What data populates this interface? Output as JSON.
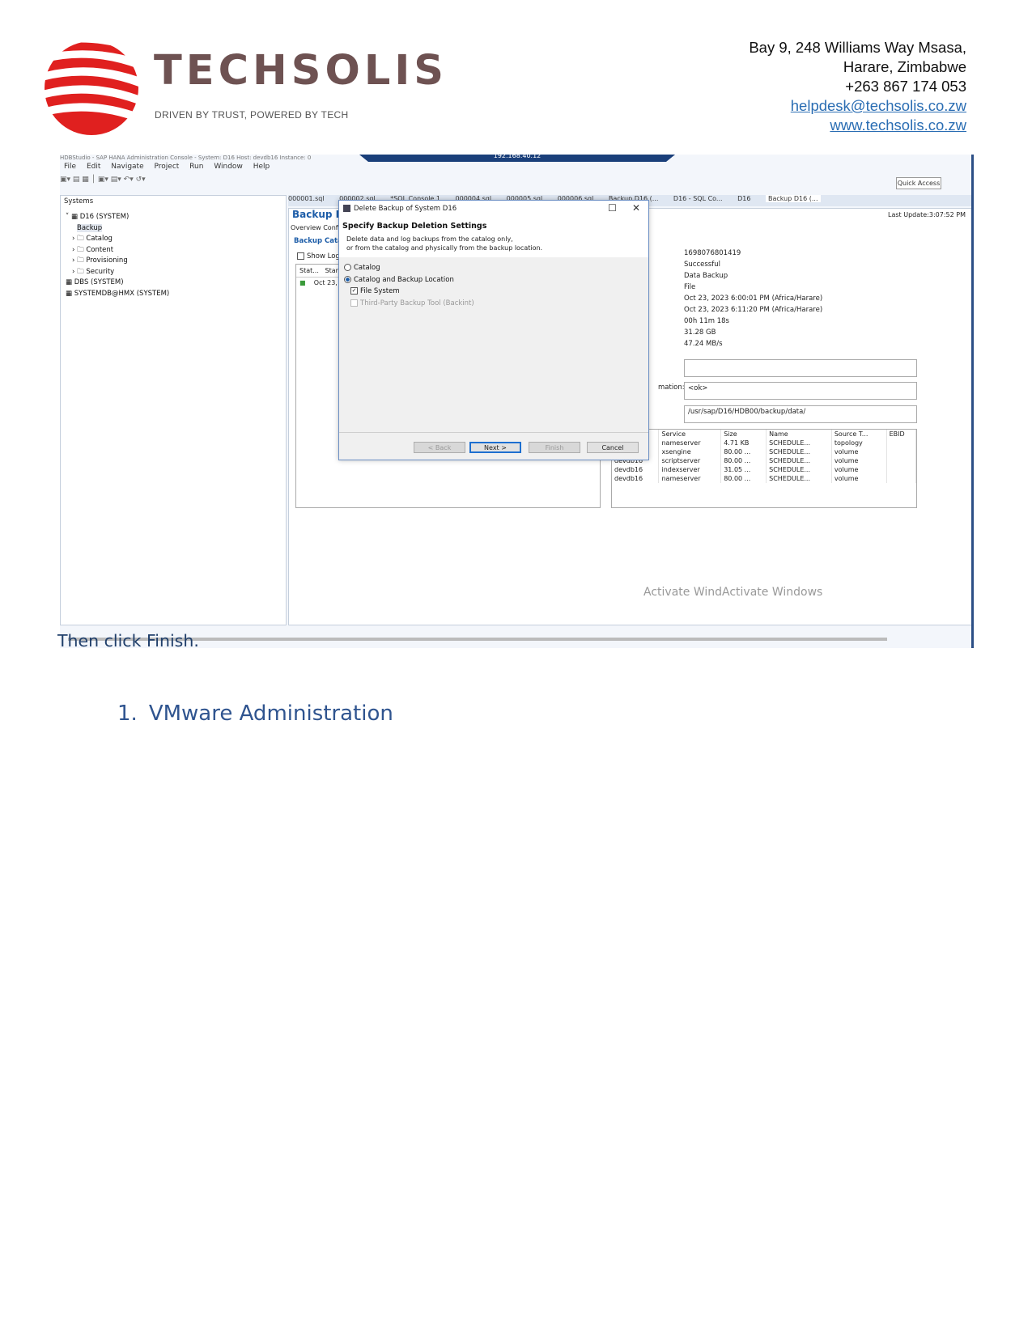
{
  "header": {
    "brand_name": "TECHSOLIS",
    "tagline": "DRIVEN BY TRUST, POWERED BY TECH",
    "address_line1": "Bay 9, 248 Williams Way Msasa,",
    "address_line2": "Harare, Zimbabwe",
    "phone": "+263 867 174 053",
    "email": "helpdesk@techsolis.co.zw",
    "website": "www.techsolis.co.zw"
  },
  "screenshot": {
    "window_title": "HDBStudio - SAP HANA Administration Console - System: D16 Host: devdb16 Instance: 0",
    "vpn_bar": "192.168.40.12",
    "menu": [
      "File",
      "Edit",
      "Navigate",
      "Project",
      "Run",
      "Window",
      "Help"
    ],
    "quick_access": "Quick Access",
    "systems_tab": "Systems",
    "tree": {
      "root": "D16 (SYSTEM)",
      "backup": "Backup",
      "catalog": "Catalog",
      "content": "Content",
      "provisioning": "Provisioning",
      "security": "Security",
      "dbs": "DBS (SYSTEM)",
      "systemdb": "SYSTEMDB@HMX (SYSTEM)"
    },
    "editor_tabs": [
      "000001.sql",
      "000002.sql",
      "*SQL Console 1",
      "000004.sql",
      "000005.sql",
      "000006.sql",
      "Backup D16 (...",
      "D16 - SQL Co...",
      "D16",
      "Backup D16 (..."
    ],
    "editor_title": "Backup D16",
    "last_update": "Last Update:3:07:52 PM",
    "subtabs": [
      "Overview",
      "Configura"
    ],
    "backup_catalog": "Backup Catalog",
    "show_log": "Show Log Back",
    "table_headers": [
      "Stat...",
      "Started"
    ],
    "table_row": "Oct 23, 20",
    "details": {
      "id": "1698076801419",
      "status": "Successful",
      "type": "Data Backup",
      "destination": "File",
      "started": "Oct 23, 2023 6:00:01 PM (Africa/Harare)",
      "finished": "Oct 23, 2023 6:11:20 PM (Africa/Harare)",
      "duration": "00h 11m 18s",
      "size": "31.28 GB",
      "throughput": "47.24 MB/s"
    },
    "info_label": "mation:",
    "info_value": "<ok>",
    "path_value": "/usr/sap/D16/HDB00/backup/data/",
    "services_headers": [
      "",
      "Service",
      "Size",
      "Name",
      "Source T...",
      "EBID"
    ],
    "services_rows": [
      [
        "",
        "nameserver",
        "4.71 KB",
        "SCHEDULE...",
        "topology",
        ""
      ],
      [
        "devdb16",
        "xsengine",
        "80.00 ...",
        "SCHEDULE...",
        "volume",
        ""
      ],
      [
        "devdb16",
        "scriptserver",
        "80.00 ...",
        "SCHEDULE...",
        "volume",
        ""
      ],
      [
        "devdb16",
        "indexserver",
        "31.05 ...",
        "SCHEDULE...",
        "volume",
        ""
      ],
      [
        "devdb16",
        "nameserver",
        "80.00 ...",
        "SCHEDULE...",
        "volume",
        ""
      ]
    ],
    "watermark": "Activate WindActivate Windows",
    "dialog": {
      "title": "Delete Backup of System D16",
      "heading": "Specify Backup Deletion Settings",
      "desc_line1": "Delete data and log backups from the catalog only,",
      "desc_line2": "or from the catalog and physically from the backup location.",
      "opt_catalog": "Catalog",
      "opt_catalog_location": "Catalog and Backup Location",
      "opt_file_system": "File System",
      "opt_third_party": "Third-Party Backup Tool (Backint)",
      "btn_back": "< Back",
      "btn_next": "Next >",
      "btn_finish": "Finish",
      "btn_cancel": "Cancel"
    }
  },
  "body": {
    "instruction": "Then click Finish.",
    "section_number": "1.",
    "section_title": "VMware Administration"
  }
}
